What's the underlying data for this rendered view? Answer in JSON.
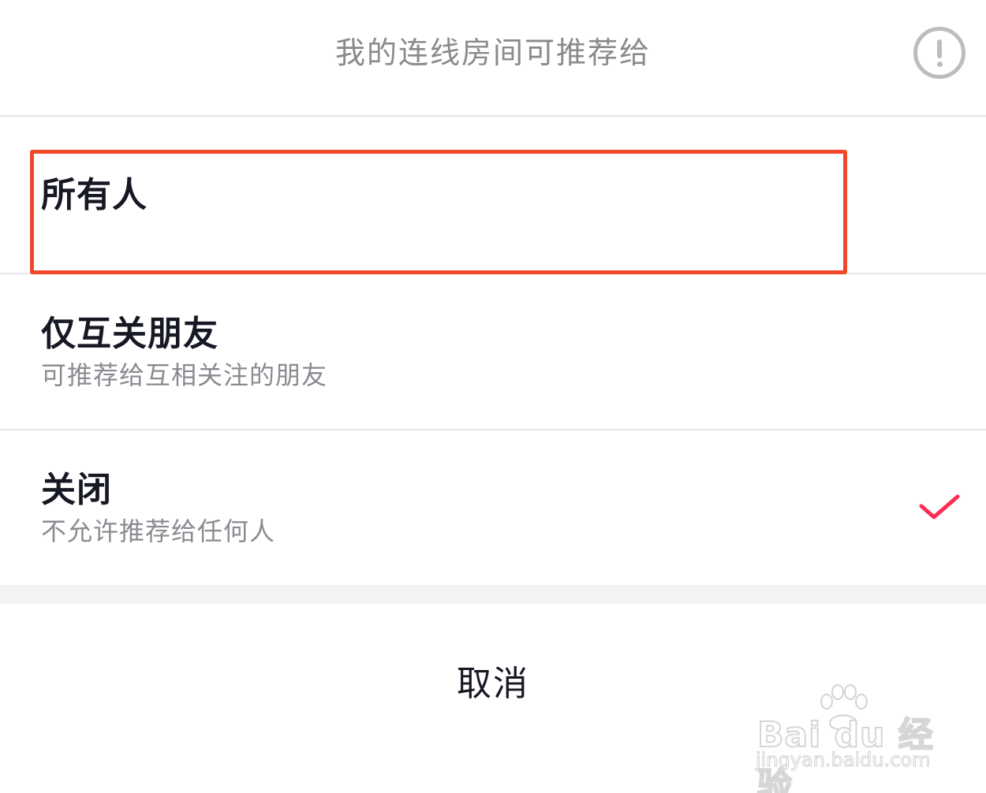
{
  "header": {
    "title": "我的连线房间可推荐给",
    "info_icon": "exclamation-circle-icon"
  },
  "options": [
    {
      "label": "所有人",
      "description": "",
      "selected": false,
      "highlighted": true
    },
    {
      "label": "仅互关朋友",
      "description": "可推荐给互相关注的朋友",
      "selected": false
    },
    {
      "label": "关闭",
      "description": "不允许推荐给任何人",
      "selected": true
    }
  ],
  "check_icon": "checkmark-icon",
  "cancel_label": "取消",
  "colors": {
    "highlight_border": "#f0492a",
    "check": "#fe2c55",
    "title_text": "#8a8a8a",
    "primary_text": "#161823",
    "secondary_text": "#8a8b91"
  },
  "watermark": {
    "brand": "Bai du 经验",
    "url": "jingyan.baidu.com"
  }
}
